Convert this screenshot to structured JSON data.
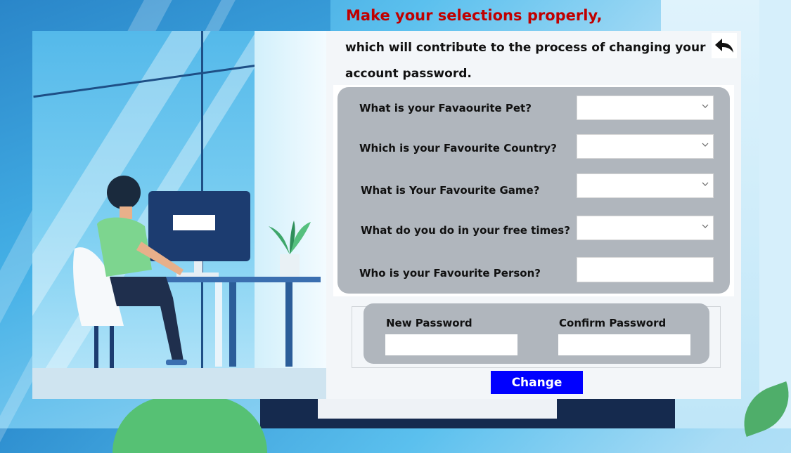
{
  "header": {
    "title": "Make your selections properly,",
    "subtitle": "which will contribute to the process of changing your account password."
  },
  "questions": [
    {
      "label": "What is your Favaourite Pet?",
      "type": "select",
      "value": ""
    },
    {
      "label": "Which is your Favourite Country?",
      "type": "select",
      "value": ""
    },
    {
      "label": "What is Your Favourite Game?",
      "type": "select",
      "value": ""
    },
    {
      "label": "What do you do in your free times?",
      "type": "select",
      "value": ""
    },
    {
      "label": "Who is your Favourite Person?",
      "type": "text",
      "value": ""
    }
  ],
  "password": {
    "new_label": "New Password",
    "confirm_label": "Confirm Password",
    "new_value": "",
    "confirm_value": ""
  },
  "actions": {
    "change_label": "Change",
    "back_icon": "back-arrow-icon"
  },
  "colors": {
    "title": "#c00000",
    "panel": "#b0b6bd",
    "button": "#0000ff"
  }
}
